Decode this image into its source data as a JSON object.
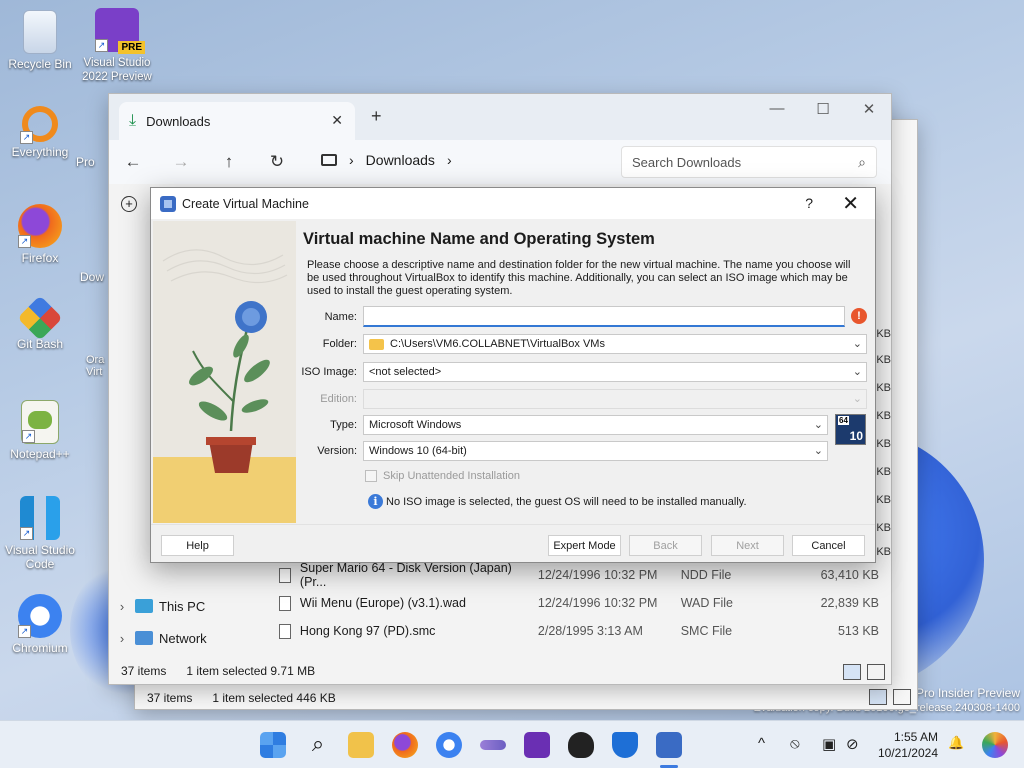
{
  "desktop": {
    "icons": [
      {
        "label": "Recycle Bin",
        "icon": "recycle-bin-icon",
        "color": "#dde7f5"
      },
      {
        "label": "Visual Studio 2022 Preview",
        "icon": "visual-studio-preview-icon",
        "badge": "PRE",
        "color": "#7a3fc8"
      },
      {
        "label": "Everything",
        "icon": "everything-search-icon",
        "color": "#f08a1c"
      },
      {
        "label": "Firefox",
        "icon": "firefox-icon",
        "color": "#e8561d"
      },
      {
        "label": "Git Bash",
        "icon": "git-bash-icon",
        "color": "#d9473a"
      },
      {
        "label": "Notepad++",
        "icon": "notepad-plus-plus-icon",
        "color": "#7cb342"
      },
      {
        "label": "Visual Studio Code",
        "icon": "vscode-icon",
        "color": "#1f8ad2"
      },
      {
        "label": "Chromium",
        "icon": "chromium-icon",
        "color": "#3c82f0"
      }
    ],
    "partial_icons": [
      "Pro",
      "Dow",
      "Ora Virt"
    ],
    "watermark": {
      "line1": "Pro Insider Preview",
      "line2": "Evaluation copy. Build 26100.ge_release.240308-1400"
    }
  },
  "back_explorer": {
    "status_count": "37 items",
    "status_selected": "1 item selected  446 KB"
  },
  "explorer": {
    "tab_title": "Downloads",
    "new_tab": "+",
    "window_controls": [
      "—",
      "☐",
      "✕"
    ],
    "nav": [
      "←",
      "→",
      "↑",
      "↻"
    ],
    "breadcrumb": [
      "Downloads"
    ],
    "search_placeholder": "Search Downloads",
    "sidebar": [
      {
        "label": "This PC",
        "icon": "this-pc-icon"
      },
      {
        "label": "Network",
        "icon": "network-icon"
      }
    ],
    "size_column_peek": [
      "KB",
      "KB",
      "KB",
      "KB",
      "KB",
      "KB",
      "KB",
      "KB",
      "KB"
    ],
    "files": [
      {
        "name": "Super Mario 64 - Disk Version (Japan) (Pr...",
        "date": "12/24/1996 10:32 PM",
        "type": "NDD File",
        "size": "63,410 KB"
      },
      {
        "name": "Wii Menu (Europe) (v3.1).wad",
        "date": "12/24/1996 10:32 PM",
        "type": "WAD File",
        "size": "22,839 KB"
      },
      {
        "name": "Hong Kong 97 (PD).smc",
        "date": "2/28/1995 3:13 AM",
        "type": "SMC File",
        "size": "513 KB"
      }
    ],
    "status_count": "37 items",
    "status_selected": "1 item selected  9.71 MB"
  },
  "dialog": {
    "title": "Create Virtual Machine",
    "help_glyph": "?",
    "close_glyph": "✕",
    "heading": "Virtual machine Name and Operating System",
    "description": "Please choose a descriptive name and destination folder for the new virtual machine. The name you choose will be used throughout VirtualBox to identify this machine. Additionally, you can select an ISO image which may be used to install the guest operating system.",
    "fields": {
      "name_label": "Name:",
      "name_value": "",
      "folder_label": "Folder:",
      "folder_value": "C:\\Users\\VM6.COLLABNET\\VirtualBox VMs",
      "iso_label": "ISO Image:",
      "iso_value": "<not selected>",
      "edition_label": "Edition:",
      "edition_value": "",
      "type_label": "Type:",
      "type_value": "Microsoft Windows",
      "version_label": "Version:",
      "version_value": "Windows 10 (64-bit)"
    },
    "os_badge": {
      "bits": "64",
      "version": "10"
    },
    "skip_unattended": "Skip Unattended Installation",
    "info_text": "No ISO image is selected, the guest OS will need to be installed manually.",
    "buttons": {
      "help": "Help",
      "expert": "Expert Mode",
      "back": "Back",
      "next": "Next",
      "cancel": "Cancel"
    }
  },
  "taskbar": {
    "apps": [
      "start-icon",
      "search-icon",
      "file-explorer-icon",
      "firefox-icon",
      "chromium-icon",
      "app-icon",
      "kde-icon",
      "inkscape-icon",
      "defender-icon",
      "virtualbox-icon"
    ],
    "tray": [
      "^",
      "⦸",
      "▣",
      "⊘"
    ],
    "time": "1:55 AM",
    "date": "10/21/2024",
    "bell": "🔔"
  }
}
